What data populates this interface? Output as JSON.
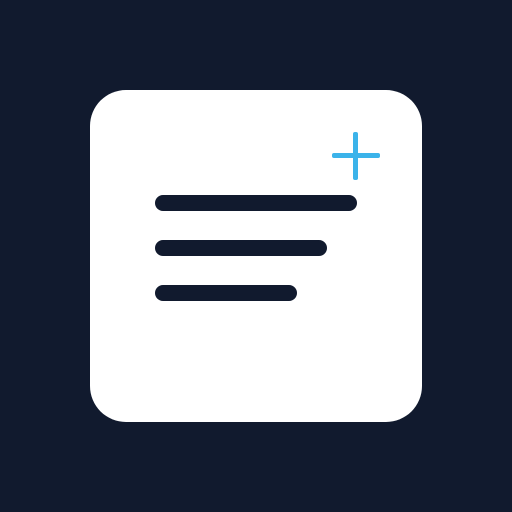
{
  "icon": {
    "name": "add-note-icon",
    "colors": {
      "background": "#111A2E",
      "card": "#FFFFFF",
      "lines": "#111A2E",
      "accent": "#3BB3EA"
    },
    "elements": {
      "card": "note-card",
      "lines_icon": "text-lines-icon",
      "plus_icon": "plus-icon"
    }
  }
}
